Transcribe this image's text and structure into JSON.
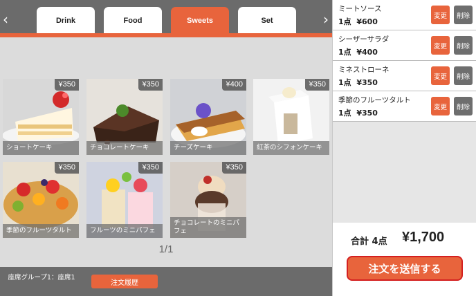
{
  "tabs": [
    {
      "label": "Drink",
      "active": false
    },
    {
      "label": "Food",
      "active": false
    },
    {
      "label": "Sweets",
      "active": true
    },
    {
      "label": "Set",
      "active": false
    }
  ],
  "nav": {
    "prev_icon": "chevron-left-icon",
    "next_icon": "chevron-right-icon"
  },
  "products": [
    {
      "name": "ショートケーキ",
      "price": "¥350"
    },
    {
      "name": "チョコレートケーキ",
      "price": "¥350"
    },
    {
      "name": "チーズケーキ",
      "price": "¥400"
    },
    {
      "name": "紅茶のシフォンケーキ",
      "price": "¥350"
    },
    {
      "name": "季節のフルーツタルト",
      "price": "¥350"
    },
    {
      "name": "フルーツのミニパフェ",
      "price": "¥350"
    },
    {
      "name": "チョコレートのミニパフェ",
      "price": "¥350"
    }
  ],
  "pager": {
    "text": "1/1"
  },
  "footer": {
    "seat": "座席グループ1：座席1",
    "history_button": "注文履歴"
  },
  "order": {
    "items": [
      {
        "name": "ミートソース",
        "qty_price": "1点  ¥600"
      },
      {
        "name": "シーザーサラダ",
        "qty_price": "1点  ¥400"
      },
      {
        "name": "ミネストローネ",
        "qty_price": "1点  ¥350"
      },
      {
        "name": "季節のフルーツタルト",
        "qty_price": "1点  ¥350"
      }
    ],
    "edit_label": "変更",
    "delete_label": "削除",
    "total_label": "合計 4点",
    "total_value": "¥1,700",
    "send_button": "注文を送信する"
  },
  "colors": {
    "accent": "#e8643c",
    "dark_bar": "#6b6b6b",
    "send_border": "#d42020"
  }
}
